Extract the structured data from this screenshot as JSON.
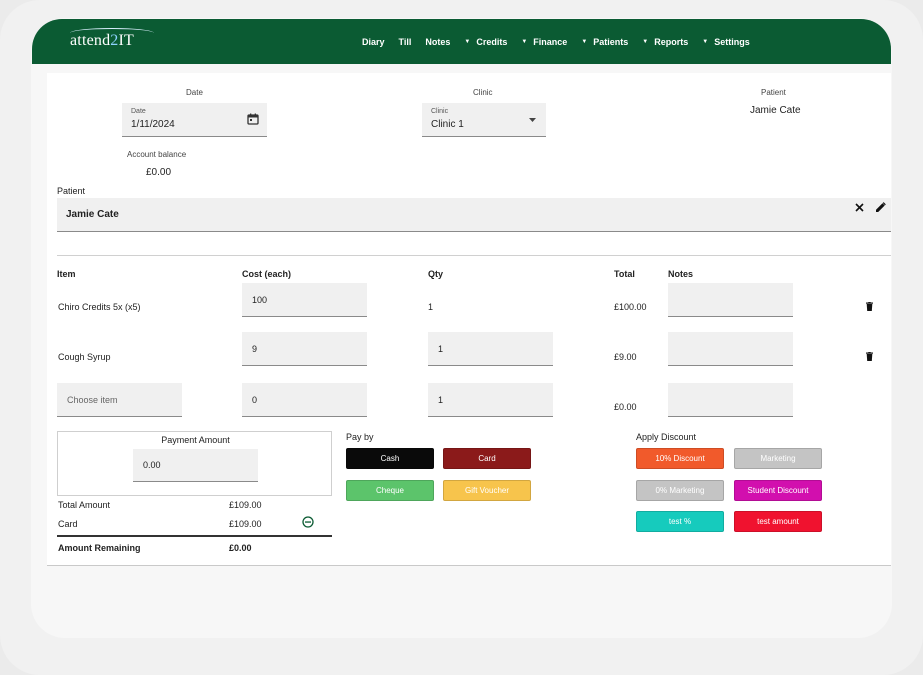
{
  "app": {
    "logo_prefix": "attend",
    "logo_two": "2",
    "logo_suffix": "IT"
  },
  "nav": {
    "items": [
      {
        "label": "Diary",
        "caret": false
      },
      {
        "label": "Till",
        "caret": false
      },
      {
        "label": "Notes",
        "caret": false
      },
      {
        "label": "Credits",
        "caret": true
      },
      {
        "label": "Finance",
        "caret": true
      },
      {
        "label": "Patients",
        "caret": true
      },
      {
        "label": "Reports",
        "caret": true
      },
      {
        "label": "Settings",
        "caret": true
      }
    ]
  },
  "top": {
    "date_heading": "Date",
    "date_field_label": "Date",
    "date_value": "1/11/2024",
    "clinic_heading": "Clinic",
    "clinic_field_label": "Clinic",
    "clinic_value": "Clinic 1",
    "patient_heading": "Patient",
    "patient_name": "Jamie Cate",
    "account_balance_label": "Account balance",
    "account_balance_value": "£0.00"
  },
  "patient_field": {
    "label": "Patient",
    "value": "Jamie Cate"
  },
  "items_table": {
    "headers": {
      "item": "Item",
      "cost": "Cost (each)",
      "qty": "Qty",
      "total": "Total",
      "notes": "Notes"
    },
    "rows": [
      {
        "item": "Chiro Credits 5x (x5)",
        "cost": "100",
        "qty": "1",
        "total": "£100.00",
        "notes": ""
      },
      {
        "item": "Cough Syrup",
        "cost": "9",
        "qty": "1",
        "total": "£9.00",
        "notes": ""
      }
    ],
    "new_row": {
      "item_placeholder": "Choose item",
      "cost": "0",
      "qty": "1",
      "total": "£0.00"
    }
  },
  "payment": {
    "amount_label": "Payment Amount",
    "amount_value": "0.00",
    "total_amount_label": "Total Amount",
    "total_amount_value": "£109.00",
    "card_label": "Card",
    "card_value": "£109.00",
    "remaining_label": "Amount Remaining",
    "remaining_value": "£0.00"
  },
  "pay_by": {
    "heading": "Pay by",
    "buttons": [
      {
        "label": "Cash",
        "bg": "#0a0a0a",
        "fg": "#ffffff"
      },
      {
        "label": "Card",
        "bg": "#8b1a1a",
        "fg": "#ffffff"
      },
      {
        "label": "Cheque",
        "bg": "#5cc46b",
        "fg": "#ffffff"
      },
      {
        "label": "Gift Voucher",
        "bg": "#f7c44c",
        "fg": "#ffffff"
      }
    ]
  },
  "discount": {
    "heading": "Apply Discount",
    "buttons": [
      {
        "label": "10% Discount",
        "bg": "#f15a2b",
        "fg": "#ffffff"
      },
      {
        "label": "Marketing",
        "bg": "#c4c4c4",
        "fg": "#ffffff"
      },
      {
        "label": "0% Marketing",
        "bg": "#c4c4c4",
        "fg": "#ffffff"
      },
      {
        "label": "Student Discount",
        "bg": "#d20fae",
        "fg": "#ffffff"
      },
      {
        "label": "test %",
        "bg": "#16cbbd",
        "fg": "#ffffff"
      },
      {
        "label": "test amount",
        "bg": "#f0122f",
        "fg": "#ffffff"
      }
    ]
  }
}
